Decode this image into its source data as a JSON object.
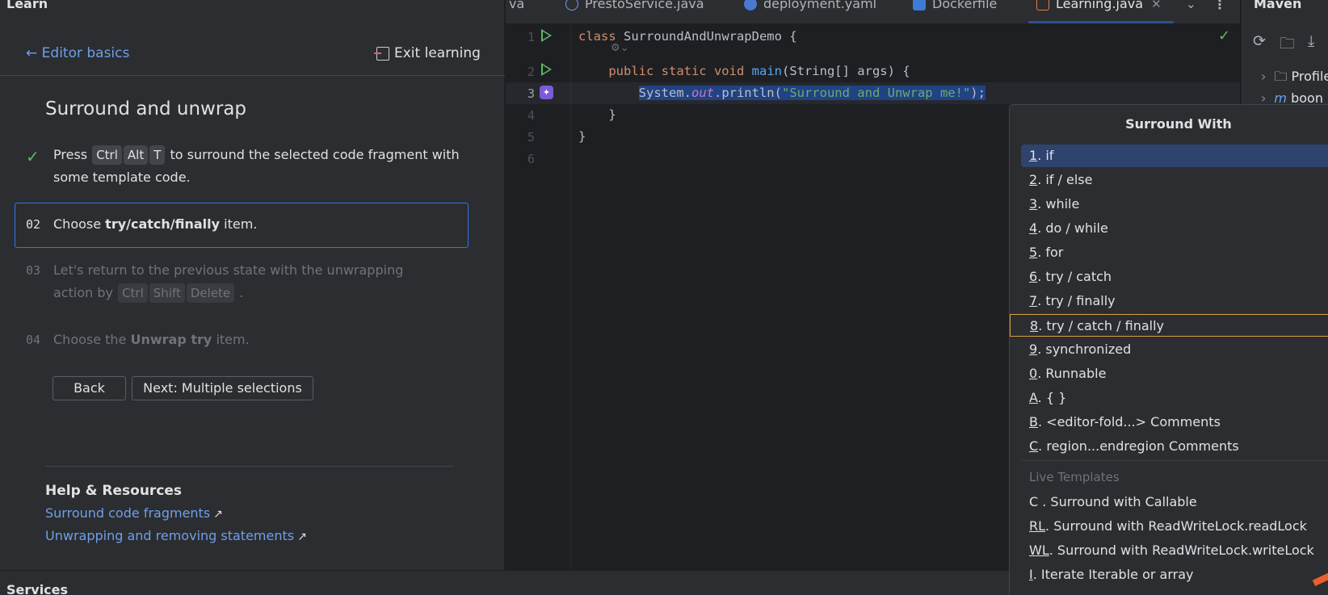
{
  "learn": {
    "panel_title": "Learn",
    "back_label": "Editor basics",
    "exit_label": "Exit learning",
    "lesson_title": "Surround and unwrap",
    "steps": [
      {
        "num": "",
        "pre": "Press",
        "keys": [
          "Ctrl",
          "Alt",
          "T"
        ],
        "post": "to surround the selected code fragment with some template code."
      },
      {
        "num": "02",
        "pre": "Choose",
        "em": "try/catch/finally",
        "post": "item."
      },
      {
        "num": "03",
        "pre": "Let's return to the previous state with the unwrapping action by",
        "keys": [
          "Ctrl",
          "Shift",
          "Delete"
        ],
        "post": "."
      },
      {
        "num": "04",
        "pre": "Choose the",
        "em": "Unwrap try",
        "post": "item."
      }
    ],
    "back_button": "Back",
    "next_button": "Next: Multiple selections",
    "help_title": "Help & Resources",
    "help_links": [
      "Surround code fragments",
      "Unwrapping and removing statements"
    ]
  },
  "tabs": [
    {
      "label": "va"
    },
    {
      "label": "PrestoService.java"
    },
    {
      "label": "deployment.yaml"
    },
    {
      "label": "Dockerfile"
    },
    {
      "label": "Learning.java",
      "active": true
    }
  ],
  "editor": {
    "line_numbers": [
      "1",
      "2",
      "3",
      "4",
      "5",
      "6"
    ],
    "current_line": "3",
    "lines": {
      "l1_kw": "class",
      "l1_rest": " SurroundAndUnwrapDemo {",
      "l2_kw": "public static void",
      "l2_fn": "main",
      "l2_rest": "(String[] args) {",
      "l3_a": "System.",
      "l3_out": "out",
      "l3_b": ".println(",
      "l3_str": "\"Surround and Unwrap me!\"",
      "l3_c": ");",
      "l4": "}",
      "l5": "}"
    }
  },
  "maven": {
    "title": "Maven",
    "tree": [
      "Profile",
      "boon"
    ]
  },
  "popup": {
    "title": "Surround With",
    "items": [
      {
        "key": "1",
        "label": ". if",
        "active": true
      },
      {
        "key": "2",
        "label": ". if / else"
      },
      {
        "key": "3",
        "label": ". while"
      },
      {
        "key": "4",
        "label": ". do / while"
      },
      {
        "key": "5",
        "label": ". for"
      },
      {
        "key": "6",
        "label": ". try / catch"
      },
      {
        "key": "7",
        "label": ". try / finally"
      },
      {
        "key": "8",
        "label": ". try / catch / finally",
        "outlined": true
      },
      {
        "key": "9",
        "label": ". synchronized"
      },
      {
        "key": "0",
        "label": ". Runnable"
      },
      {
        "key": "A",
        "label": ". { }"
      },
      {
        "key": "B",
        "label": ". <editor-fold...> Comments"
      },
      {
        "key": "C",
        "label": ". region...endregion Comments"
      }
    ],
    "section_label": "Live Templates",
    "templates": [
      {
        "key": "C",
        "label": " . Surround with Callable",
        "underline": false
      },
      {
        "key": "RL",
        "label": ". Surround with ReadWriteLock.readLock",
        "underline": true
      },
      {
        "key": "WL",
        "label": ". Surround with ReadWriteLock.writeLock",
        "underline": true
      },
      {
        "key": "I",
        "label": ". Iterate Iterable or array",
        "underline": true
      }
    ]
  },
  "bottom": {
    "services_title": "Services"
  }
}
